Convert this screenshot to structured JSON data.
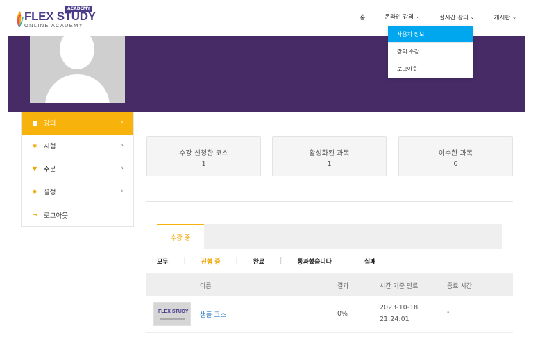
{
  "header": {
    "logo": {
      "brand_flex": "FLEX",
      "brand_study": "STUDY",
      "badge": "ACADEMY",
      "subtitle": "ONLINE ACADEMY"
    },
    "nav": [
      {
        "label": "홈",
        "has_chevron": false
      },
      {
        "label": "온라인 강의",
        "has_chevron": true,
        "active": true
      },
      {
        "label": "실시간 강의",
        "has_chevron": true
      },
      {
        "label": "게시판",
        "has_chevron": true
      }
    ],
    "chevron_glyph": "⌄"
  },
  "dropdown": {
    "items": [
      {
        "label": "사용자 정보",
        "active": true
      },
      {
        "label": "강의 수강"
      },
      {
        "label": "로그아웃"
      }
    ]
  },
  "sidebar": {
    "items": [
      {
        "label": "강의",
        "icon": "book-icon",
        "glyph": "■",
        "arrow": "‹",
        "active": true
      },
      {
        "label": "시험",
        "icon": "puzzle-icon",
        "glyph": "✱",
        "arrow": "›"
      },
      {
        "label": "주문",
        "icon": "cart-icon",
        "glyph": "▼",
        "arrow": "›"
      },
      {
        "label": "설정",
        "icon": "gear-icon",
        "glyph": "✹",
        "arrow": "›"
      },
      {
        "label": "로그아웃",
        "icon": "logout-icon",
        "glyph": "⇥",
        "arrow": ""
      }
    ]
  },
  "stats": [
    {
      "label": "수강 신청한 코스",
      "value": "1"
    },
    {
      "label": "활성화된 과목",
      "value": "1"
    },
    {
      "label": "이수한 과목",
      "value": "0"
    }
  ],
  "tabs": {
    "active_label": "수강 중"
  },
  "filters": {
    "items": [
      {
        "label": "모두"
      },
      {
        "label": "진행 중",
        "active": true
      },
      {
        "label": "완료"
      },
      {
        "label": "통과했습니다"
      },
      {
        "label": "실패"
      }
    ],
    "separator": "|"
  },
  "table": {
    "headers": {
      "name": "이름",
      "result": "결과",
      "expiry": "시간 기준 만료",
      "end": "종료 시간"
    },
    "rows": [
      {
        "name": "샘플 코스",
        "result": "0%",
        "expiry_date": "2023-10-18",
        "expiry_time": "21:24:01",
        "end": "-",
        "thumb_text": "FLEX STUDY"
      }
    ]
  },
  "colors": {
    "accent": "#f7b30b",
    "banner": "#462b66",
    "dropdown_active": "#00a6ee",
    "link": "#2b7bc4",
    "brand": "#4a3a8a"
  }
}
